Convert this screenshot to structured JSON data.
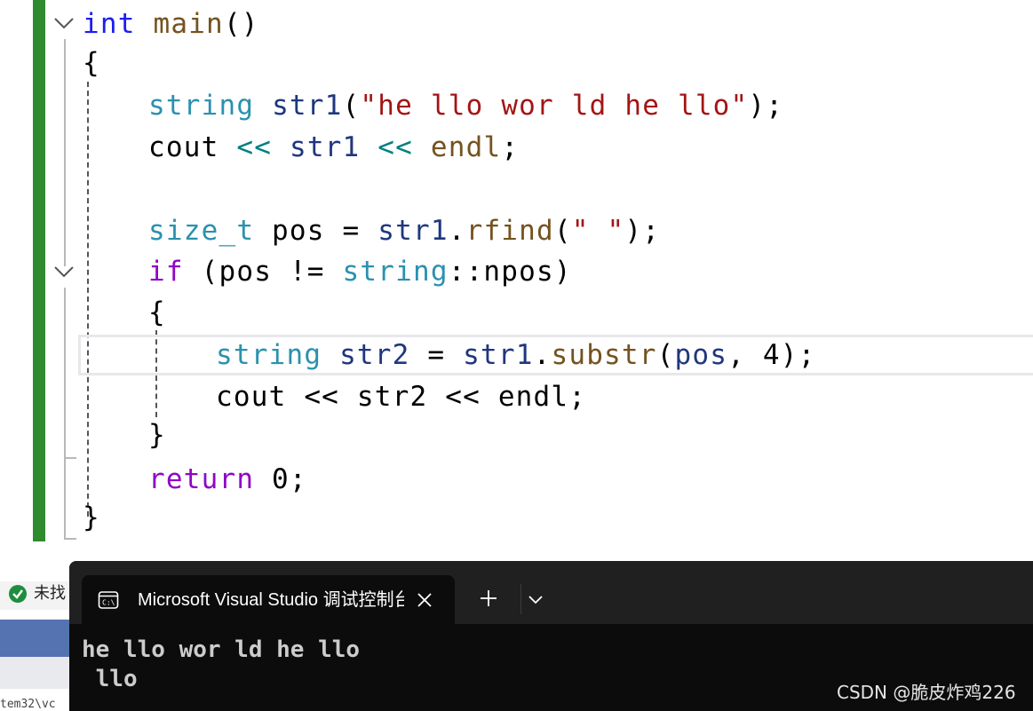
{
  "editor": {
    "lines": [
      {
        "id": "l1",
        "parts": [
          {
            "t": "int",
            "c": "kw"
          },
          {
            "t": " "
          },
          {
            "t": "main",
            "c": "fn"
          },
          {
            "t": "()"
          }
        ]
      },
      {
        "id": "l2",
        "parts": [
          {
            "t": "{"
          }
        ]
      },
      {
        "id": "l3",
        "parts": [
          {
            "t": "string",
            "c": "ty"
          },
          {
            "t": " "
          },
          {
            "t": "str1",
            "c": "var"
          },
          {
            "t": "("
          },
          {
            "t": "\"he llo wor ld he llo\"",
            "c": "str"
          },
          {
            "t": ");"
          }
        ]
      },
      {
        "id": "l4",
        "parts": [
          {
            "t": "cout"
          },
          {
            "t": " "
          },
          {
            "t": "<<",
            "c": "op"
          },
          {
            "t": " "
          },
          {
            "t": "str1",
            "c": "var"
          },
          {
            "t": " "
          },
          {
            "t": "<<",
            "c": "op"
          },
          {
            "t": " "
          },
          {
            "t": "endl",
            "c": "fn"
          },
          {
            "t": ";"
          }
        ]
      },
      {
        "id": "l5",
        "parts": [
          {
            "t": ""
          }
        ]
      },
      {
        "id": "l6",
        "parts": [
          {
            "t": "size_t",
            "c": "ty"
          },
          {
            "t": " pos = "
          },
          {
            "t": "str1",
            "c": "var"
          },
          {
            "t": "."
          },
          {
            "t": "rfind",
            "c": "fn"
          },
          {
            "t": "("
          },
          {
            "t": "\" \"",
            "c": "str"
          },
          {
            "t": ");"
          }
        ]
      },
      {
        "id": "l7",
        "parts": [
          {
            "t": "if",
            "c": "kw2"
          },
          {
            "t": " (pos != "
          },
          {
            "t": "string",
            "c": "ty"
          },
          {
            "t": "::npos)"
          }
        ]
      },
      {
        "id": "l8",
        "parts": [
          {
            "t": "{"
          }
        ]
      },
      {
        "id": "l9",
        "parts": [
          {
            "t": "string",
            "c": "ty"
          },
          {
            "t": " "
          },
          {
            "t": "str2",
            "c": "var"
          },
          {
            "t": " = "
          },
          {
            "t": "str1",
            "c": "var"
          },
          {
            "t": "."
          },
          {
            "t": "substr",
            "c": "fn"
          },
          {
            "t": "("
          },
          {
            "t": "pos",
            "c": "var"
          },
          {
            "t": ", 4);"
          }
        ]
      },
      {
        "id": "l10",
        "parts": [
          {
            "t": "cout << str2 << endl;"
          }
        ]
      },
      {
        "id": "l11",
        "parts": [
          {
            "t": "}"
          }
        ]
      },
      {
        "id": "l12",
        "parts": [
          {
            "t": "return",
            "c": "kw2"
          },
          {
            "t": " 0;"
          }
        ]
      },
      {
        "id": "l13",
        "parts": [
          {
            "t": "}"
          }
        ]
      }
    ]
  },
  "background_window": {
    "status_text": "未找",
    "path_text": "tem32\\vc"
  },
  "terminal": {
    "tab_title": "Microsoft Visual Studio 调试控制台",
    "output_lines": [
      "he llo wor ld he llo",
      " llo"
    ]
  },
  "watermark": "CSDN @脆皮炸鸡226",
  "colors": {
    "change_bar": "#2e8b2e",
    "keyword": "#1d1df0",
    "control_keyword": "#8f08c4",
    "type": "#2b91af",
    "function": "#74531f",
    "string": "#a31515",
    "operator": "#008080",
    "variable": "#1f377f",
    "terminal_bg": "#0c0c0c",
    "tab_strip_bg": "#202020"
  },
  "icons": {
    "fold": "chevron-down-icon",
    "terminal": "console-icon",
    "close": "close-icon",
    "new_tab": "plus-icon",
    "dropdown": "chevron-down-icon",
    "status": "check-circle-icon"
  }
}
